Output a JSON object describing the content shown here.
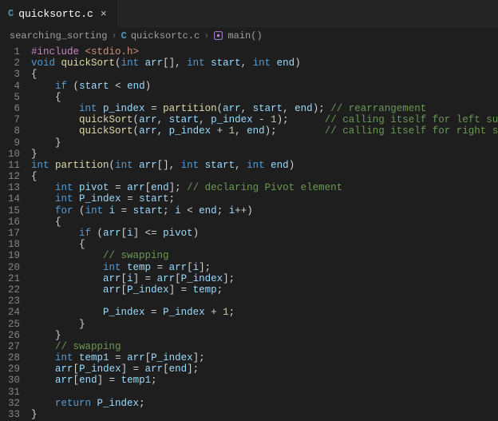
{
  "tab": {
    "icon_letter": "C",
    "filename": "quicksortc.c",
    "close": "×"
  },
  "breadcrumb": {
    "folder": "searching_sorting",
    "file": "quicksortc.c",
    "symbol": "main()",
    "file_icon_letter": "C",
    "sep": "›"
  },
  "code": {
    "first_line": 1,
    "lines": [
      [
        [
          "mac",
          "#include "
        ],
        [
          "str",
          "<stdio.h>"
        ]
      ],
      [
        [
          "kw",
          "void "
        ],
        [
          "fn",
          "quickSort"
        ],
        [
          "pun",
          "("
        ],
        [
          "kw",
          "int "
        ],
        [
          "var",
          "arr"
        ],
        [
          "pun",
          "[], "
        ],
        [
          "kw",
          "int "
        ],
        [
          "var",
          "start"
        ],
        [
          "pun",
          ", "
        ],
        [
          "kw",
          "int "
        ],
        [
          "var",
          "end"
        ],
        [
          "pun",
          ")"
        ]
      ],
      [
        [
          "pun",
          "{"
        ]
      ],
      [
        [
          "pun",
          "    "
        ],
        [
          "kw",
          "if"
        ],
        [
          "pun",
          " ("
        ],
        [
          "var",
          "start"
        ],
        [
          "pun",
          " < "
        ],
        [
          "var",
          "end"
        ],
        [
          "pun",
          ")"
        ]
      ],
      [
        [
          "pun",
          "    {"
        ]
      ],
      [
        [
          "pun",
          "        "
        ],
        [
          "kw",
          "int "
        ],
        [
          "var",
          "p_index"
        ],
        [
          "pun",
          " = "
        ],
        [
          "fn",
          "partition"
        ],
        [
          "pun",
          "("
        ],
        [
          "var",
          "arr"
        ],
        [
          "pun",
          ", "
        ],
        [
          "var",
          "start"
        ],
        [
          "pun",
          ", "
        ],
        [
          "var",
          "end"
        ],
        [
          "pun",
          "); "
        ],
        [
          "cmt",
          "// rearrangement"
        ]
      ],
      [
        [
          "pun",
          "        "
        ],
        [
          "fn",
          "quickSort"
        ],
        [
          "pun",
          "("
        ],
        [
          "var",
          "arr"
        ],
        [
          "pun",
          ", "
        ],
        [
          "var",
          "start"
        ],
        [
          "pun",
          ", "
        ],
        [
          "var",
          "p_index"
        ],
        [
          "pun",
          " - "
        ],
        [
          "num",
          "1"
        ],
        [
          "pun",
          ");      "
        ],
        [
          "cmt",
          "// calling itself for left sub array"
        ]
      ],
      [
        [
          "pun",
          "        "
        ],
        [
          "fn",
          "quickSort"
        ],
        [
          "pun",
          "("
        ],
        [
          "var",
          "arr"
        ],
        [
          "pun",
          ", "
        ],
        [
          "var",
          "p_index"
        ],
        [
          "pun",
          " + "
        ],
        [
          "num",
          "1"
        ],
        [
          "pun",
          ", "
        ],
        [
          "var",
          "end"
        ],
        [
          "pun",
          ");        "
        ],
        [
          "cmt",
          "// calling itself for right sub array"
        ]
      ],
      [
        [
          "pun",
          "    }"
        ]
      ],
      [
        [
          "pun",
          "}"
        ]
      ],
      [
        [
          "kw",
          "int "
        ],
        [
          "fn",
          "partition"
        ],
        [
          "pun",
          "("
        ],
        [
          "kw",
          "int "
        ],
        [
          "var",
          "arr"
        ],
        [
          "pun",
          "[], "
        ],
        [
          "kw",
          "int "
        ],
        [
          "var",
          "start"
        ],
        [
          "pun",
          ", "
        ],
        [
          "kw",
          "int "
        ],
        [
          "var",
          "end"
        ],
        [
          "pun",
          ")"
        ]
      ],
      [
        [
          "pun",
          "{"
        ]
      ],
      [
        [
          "pun",
          "    "
        ],
        [
          "kw",
          "int "
        ],
        [
          "var",
          "pivot"
        ],
        [
          "pun",
          " = "
        ],
        [
          "var",
          "arr"
        ],
        [
          "pun",
          "["
        ],
        [
          "var",
          "end"
        ],
        [
          "pun",
          "]; "
        ],
        [
          "cmt",
          "// declaring Pivot element"
        ]
      ],
      [
        [
          "pun",
          "    "
        ],
        [
          "kw",
          "int "
        ],
        [
          "var",
          "P_index"
        ],
        [
          "pun",
          " = "
        ],
        [
          "var",
          "start"
        ],
        [
          "pun",
          ";"
        ]
      ],
      [
        [
          "pun",
          "    "
        ],
        [
          "kw",
          "for"
        ],
        [
          "pun",
          " ("
        ],
        [
          "kw",
          "int "
        ],
        [
          "var",
          "i"
        ],
        [
          "pun",
          " = "
        ],
        [
          "var",
          "start"
        ],
        [
          "pun",
          "; "
        ],
        [
          "var",
          "i"
        ],
        [
          "pun",
          " < "
        ],
        [
          "var",
          "end"
        ],
        [
          "pun",
          "; "
        ],
        [
          "var",
          "i"
        ],
        [
          "pun",
          "++)"
        ]
      ],
      [
        [
          "pun",
          "    {"
        ]
      ],
      [
        [
          "pun",
          "        "
        ],
        [
          "kw",
          "if"
        ],
        [
          "pun",
          " ("
        ],
        [
          "var",
          "arr"
        ],
        [
          "pun",
          "["
        ],
        [
          "var",
          "i"
        ],
        [
          "pun",
          "] <= "
        ],
        [
          "var",
          "pivot"
        ],
        [
          "pun",
          ")"
        ]
      ],
      [
        [
          "pun",
          "        {"
        ]
      ],
      [
        [
          "pun",
          "            "
        ],
        [
          "cmt",
          "// swapping"
        ]
      ],
      [
        [
          "pun",
          "            "
        ],
        [
          "kw",
          "int "
        ],
        [
          "var",
          "temp"
        ],
        [
          "pun",
          " = "
        ],
        [
          "var",
          "arr"
        ],
        [
          "pun",
          "["
        ],
        [
          "var",
          "i"
        ],
        [
          "pun",
          "];"
        ]
      ],
      [
        [
          "pun",
          "            "
        ],
        [
          "var",
          "arr"
        ],
        [
          "pun",
          "["
        ],
        [
          "var",
          "i"
        ],
        [
          "pun",
          "] = "
        ],
        [
          "var",
          "arr"
        ],
        [
          "pun",
          "["
        ],
        [
          "var",
          "P_index"
        ],
        [
          "pun",
          "];"
        ]
      ],
      [
        [
          "pun",
          "            "
        ],
        [
          "var",
          "arr"
        ],
        [
          "pun",
          "["
        ],
        [
          "var",
          "P_index"
        ],
        [
          "pun",
          "] = "
        ],
        [
          "var",
          "temp"
        ],
        [
          "pun",
          ";"
        ]
      ],
      [
        [
          "pun",
          ""
        ]
      ],
      [
        [
          "pun",
          "            "
        ],
        [
          "var",
          "P_index"
        ],
        [
          "pun",
          " = "
        ],
        [
          "var",
          "P_index"
        ],
        [
          "pun",
          " + "
        ],
        [
          "num",
          "1"
        ],
        [
          "pun",
          ";"
        ]
      ],
      [
        [
          "pun",
          "        }"
        ]
      ],
      [
        [
          "pun",
          "    }"
        ]
      ],
      [
        [
          "pun",
          "    "
        ],
        [
          "cmt",
          "// swapping"
        ]
      ],
      [
        [
          "pun",
          "    "
        ],
        [
          "kw",
          "int "
        ],
        [
          "var",
          "temp1"
        ],
        [
          "pun",
          " = "
        ],
        [
          "var",
          "arr"
        ],
        [
          "pun",
          "["
        ],
        [
          "var",
          "P_index"
        ],
        [
          "pun",
          "];"
        ]
      ],
      [
        [
          "pun",
          "    "
        ],
        [
          "var",
          "arr"
        ],
        [
          "pun",
          "["
        ],
        [
          "var",
          "P_index"
        ],
        [
          "pun",
          "] = "
        ],
        [
          "var",
          "arr"
        ],
        [
          "pun",
          "["
        ],
        [
          "var",
          "end"
        ],
        [
          "pun",
          "];"
        ]
      ],
      [
        [
          "pun",
          "    "
        ],
        [
          "var",
          "arr"
        ],
        [
          "pun",
          "["
        ],
        [
          "var",
          "end"
        ],
        [
          "pun",
          "] = "
        ],
        [
          "var",
          "temp1"
        ],
        [
          "pun",
          ";"
        ]
      ],
      [
        [
          "pun",
          ""
        ]
      ],
      [
        [
          "pun",
          "    "
        ],
        [
          "kw",
          "return "
        ],
        [
          "var",
          "P_index"
        ],
        [
          "pun",
          ";"
        ]
      ],
      [
        [
          "pun",
          "}"
        ]
      ]
    ]
  }
}
